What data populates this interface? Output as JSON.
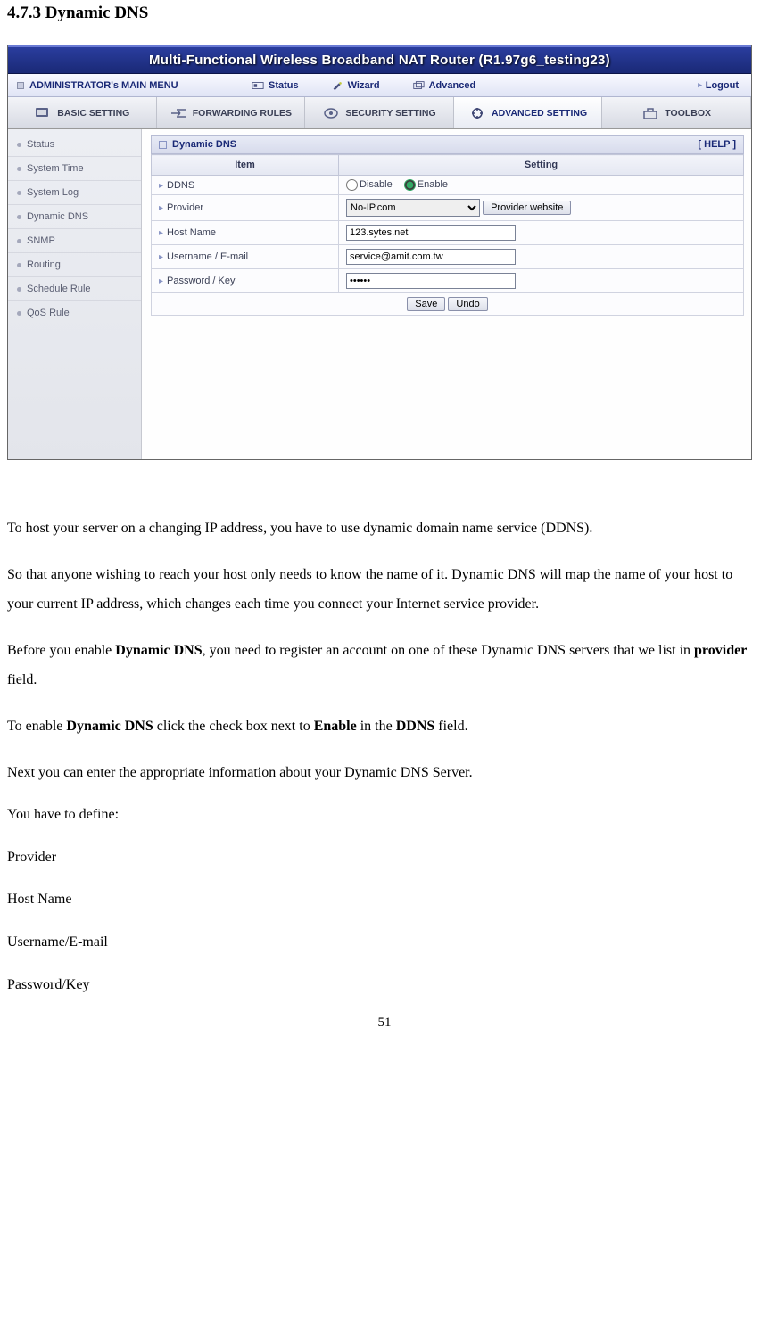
{
  "heading": "4.7.3 Dynamic DNS",
  "router": {
    "title": "Multi-Functional Wireless Broadband NAT Router (R1.97g6_testing23)",
    "menubar": {
      "admin": "ADMINISTRATOR's MAIN MENU",
      "status": "Status",
      "wizard": "Wizard",
      "advanced": "Advanced",
      "logout": "Logout"
    },
    "tabs": {
      "basic": "BASIC SETTING",
      "forwarding": "FORWARDING RULES",
      "security": "SECURITY SETTING",
      "advanced": "ADVANCED SETTING",
      "toolbox": "TOOLBOX"
    },
    "sidebar": [
      "Status",
      "System Time",
      "System Log",
      "Dynamic DNS",
      "SNMP",
      "Routing",
      "Schedule Rule",
      "QoS Rule"
    ],
    "panel": {
      "title": "Dynamic DNS",
      "help": "[ HELP ]",
      "col_item": "Item",
      "col_setting": "Setting",
      "rows": {
        "ddns_label": "DDNS",
        "disable": "Disable",
        "enable": "Enable",
        "provider_label": "Provider",
        "provider_value": "No-IP.com",
        "provider_btn": "Provider website",
        "hostname_label": "Host Name",
        "hostname_value": "123.sytes.net",
        "user_label": "Username / E-mail",
        "user_value": "service@amit.com.tw",
        "pass_label": "Password / Key",
        "pass_value": "******"
      },
      "save": "Save",
      "undo": "Undo"
    }
  },
  "body": {
    "p1": "To host your server on a changing IP address, you have to use dynamic domain name service (DDNS).",
    "p2": "So that anyone wishing to reach your host only needs to know the name of it. Dynamic DNS will map the name of your host to your current IP address, which changes each time you connect your Internet service provider.",
    "p3a": "Before you enable ",
    "p3b": "Dynamic DNS",
    "p3c": ", you need to register an account on one of these Dynamic DNS servers that we list in ",
    "p3d": "provider",
    "p3e": " field.",
    "p4a": "To enable ",
    "p4b": "Dynamic DNS",
    "p4c": " click the check box next to ",
    "p4d": "Enable",
    "p4e": " in the ",
    "p4f": "DDNS",
    "p4g": " field.",
    "p5": "Next you can enter the appropriate information about your Dynamic DNS Server.",
    "p6": "You have to define:",
    "l1": "Provider",
    "l2": "Host Name",
    "l3": "Username/E-mail",
    "l4": "Password/Key"
  },
  "page_number": "51"
}
